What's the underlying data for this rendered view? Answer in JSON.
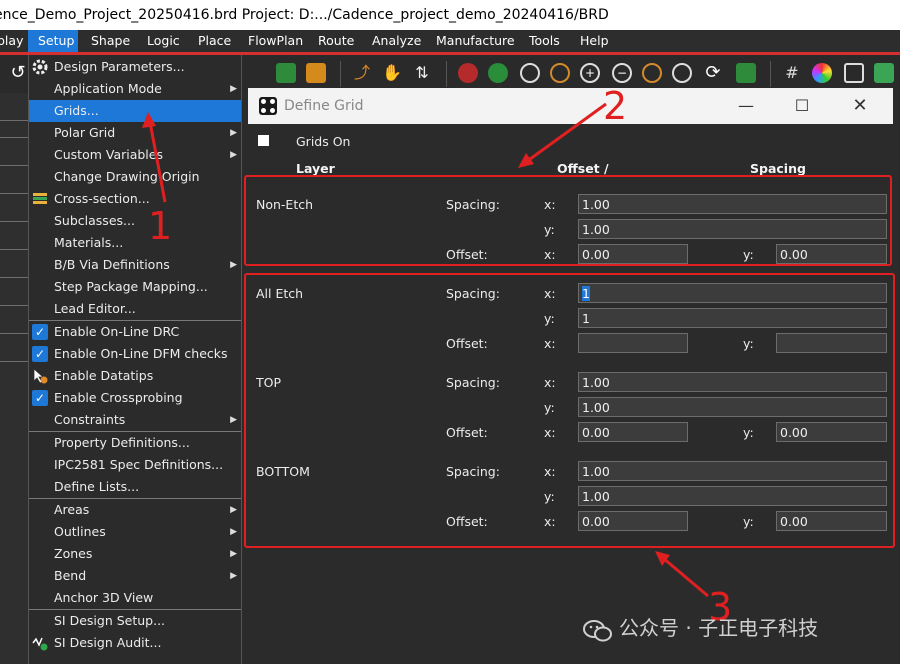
{
  "window": {
    "title": "ence_Demo_Project_20250416.brd  Project: D:.../Cadence_project_demo_20240416/BRD"
  },
  "menubar": {
    "items": [
      {
        "label": "play",
        "active": false
      },
      {
        "label": "Setup",
        "active": true
      },
      {
        "label": "Shape",
        "active": false
      },
      {
        "label": "Logic",
        "active": false
      },
      {
        "label": "Place",
        "active": false
      },
      {
        "label": "FlowPlan",
        "active": false
      },
      {
        "label": "Route",
        "active": false
      },
      {
        "label": "Analyze",
        "active": false
      },
      {
        "label": "Manufacture",
        "active": false
      },
      {
        "label": "Tools",
        "active": false
      },
      {
        "label": "Help",
        "active": false
      }
    ]
  },
  "setup_menu": {
    "items": [
      {
        "label": "Design Parameters...",
        "submenu": false,
        "checked": false,
        "icon": "gear-icon"
      },
      {
        "label": "Application Mode",
        "submenu": true,
        "checked": false
      },
      {
        "label": "Grids...",
        "submenu": false,
        "checked": false,
        "highlighted": true
      },
      {
        "label": "Polar Grid",
        "submenu": true,
        "checked": false
      },
      {
        "label": "Custom Variables",
        "submenu": true,
        "checked": false
      },
      {
        "label": "Change Drawing Origin",
        "submenu": false,
        "checked": false
      },
      {
        "label": "Cross-section...",
        "submenu": false,
        "checked": false,
        "icon": "layer-stack-icon"
      },
      {
        "label": "Subclasses...",
        "submenu": false,
        "checked": false
      },
      {
        "label": "Materials...",
        "submenu": false,
        "checked": false
      },
      {
        "label": "B/B Via Definitions",
        "submenu": true,
        "checked": false
      },
      {
        "label": "Step Package Mapping...",
        "submenu": false,
        "checked": false
      },
      {
        "label": "Lead Editor...",
        "submenu": false,
        "checked": false
      },
      {
        "label": "Enable On-Line DRC",
        "submenu": false,
        "checked": true
      },
      {
        "label": "Enable On-Line DFM checks",
        "submenu": false,
        "checked": true
      },
      {
        "label": "Enable Datatips",
        "submenu": false,
        "checked": false,
        "icon": "datatip-icon"
      },
      {
        "label": "Enable Crossprobing",
        "submenu": false,
        "checked": true
      },
      {
        "label": "Constraints",
        "submenu": true,
        "checked": false
      },
      {
        "label": "Property Definitions...",
        "submenu": false,
        "checked": false
      },
      {
        "label": "IPC2581 Spec Definitions...",
        "submenu": false,
        "checked": false
      },
      {
        "label": "Define Lists...",
        "submenu": false,
        "checked": false
      },
      {
        "label": "Areas",
        "submenu": true,
        "checked": false
      },
      {
        "label": "Outlines",
        "submenu": true,
        "checked": false
      },
      {
        "label": "Zones",
        "submenu": true,
        "checked": false
      },
      {
        "label": "Bend",
        "submenu": true,
        "checked": false
      },
      {
        "label": "Anchor 3D View",
        "submenu": false,
        "checked": false
      },
      {
        "label": "SI Design Setup...",
        "submenu": false,
        "checked": false
      },
      {
        "label": "SI Design Audit...",
        "submenu": false,
        "checked": false,
        "icon": "audit-icon"
      }
    ]
  },
  "dialog": {
    "title": "Define Grid",
    "grids_on_label": "Grids On",
    "headers": {
      "layer": "Layer",
      "offset": "Offset  /",
      "spacing": "Spacing"
    },
    "sections": [
      {
        "name": "Non-Etch",
        "rows": [
          {
            "label": "Spacing:",
            "x": "1.00",
            "y": "1.00"
          },
          {
            "label": "Offset:",
            "x": "0.00",
            "y": "0.00"
          }
        ]
      },
      {
        "name": "All Etch",
        "rows": [
          {
            "label": "Spacing:",
            "x": "1",
            "y": "1"
          },
          {
            "label": "Offset:",
            "x": "",
            "y": ""
          }
        ]
      },
      {
        "name": "TOP",
        "rows": [
          {
            "label": "Spacing:",
            "x": "1.00",
            "y": "1.00"
          },
          {
            "label": "Offset:",
            "x": "0.00",
            "y": "0.00"
          }
        ]
      },
      {
        "name": "BOTTOM",
        "rows": [
          {
            "label": "Spacing:",
            "x": "1.00",
            "y": "1.00"
          },
          {
            "label": "Offset:",
            "x": "0.00",
            "y": "0.00"
          }
        ]
      }
    ],
    "axis_x": "x:",
    "axis_y": "y:"
  },
  "annotations": {
    "n1": "1",
    "n2": "2",
    "n3": "3",
    "color": "#e02020"
  },
  "watermark": {
    "text": "公众号 · 子正电子科技"
  }
}
